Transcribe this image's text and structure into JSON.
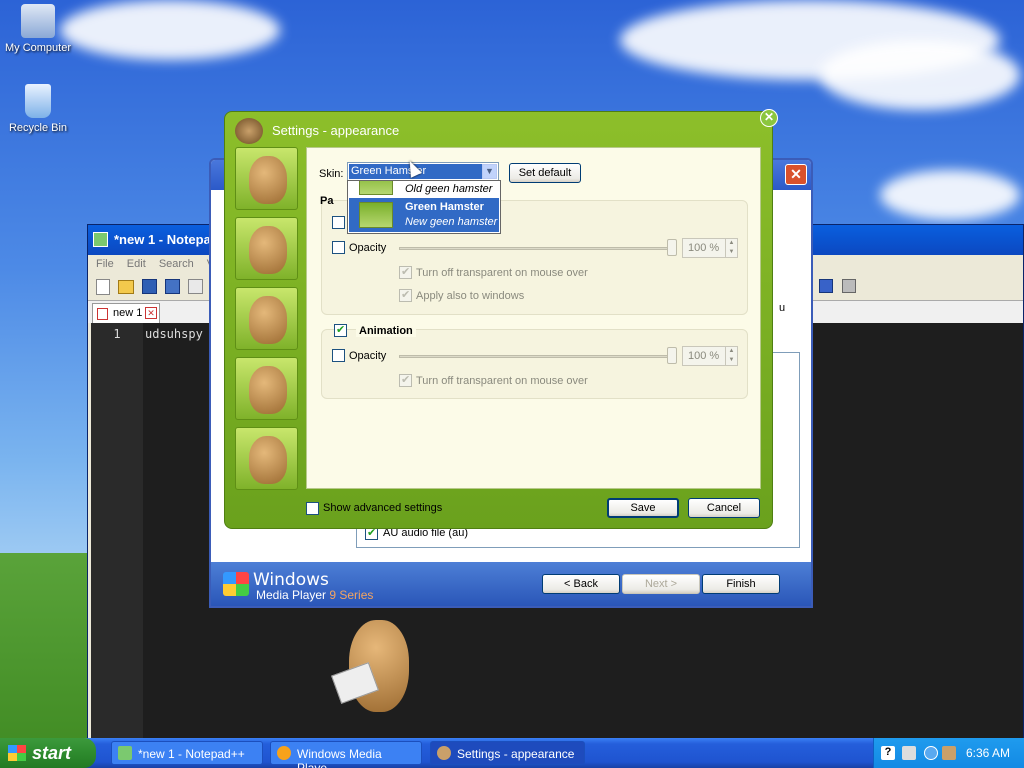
{
  "desktop": {
    "icons": [
      {
        "label": "My Computer",
        "icon": "my-computer-icon"
      },
      {
        "label": "Recycle Bin",
        "icon": "recycle-bin-icon"
      }
    ]
  },
  "notepad": {
    "title": "*new 1 - Notepa",
    "menu": [
      "File",
      "Edit",
      "Search",
      "Vi"
    ],
    "tab_label": "new 1",
    "line_number": "1",
    "code": "udsuhspy"
  },
  "wmp": {
    "list_item": "AU audio file (au)",
    "partial_text": "u",
    "brand_line1": "Windows",
    "brand_line2": "Media Player",
    "brand_series": "9 Series",
    "back_label": "< Back",
    "next_label": "Next >",
    "finish_label": "Finish"
  },
  "settings": {
    "title": "Settings - appearance",
    "skin_label": "Skin:",
    "skin_value": "Green Hamster",
    "set_default_label": "Set default",
    "group1": {
      "title_partial": "Pa",
      "opacity_label": "Opacity",
      "opacity_value": "100 %",
      "transparent_label": "Turn off transparent on mouse over",
      "apply_windows_label": "Apply also to windows"
    },
    "group2": {
      "title": "Animation",
      "opacity_label": "Opacity",
      "opacity_value": "100 %",
      "transparent_label": "Turn off transparent on mouse over"
    },
    "show_advanced_label": "Show advanced settings",
    "save_label": "Save",
    "cancel_label": "Cancel"
  },
  "skin_dropdown": {
    "options": [
      {
        "name": "",
        "desc": "Old geen hamster",
        "selected": false
      },
      {
        "name": "Green Hamster",
        "desc": "New geen hamster",
        "selected": true
      }
    ]
  },
  "taskbar": {
    "start_label": "start",
    "items": [
      {
        "label": "*new 1 - Notepad++",
        "icon": "notepad-icon"
      },
      {
        "label": "Windows Media Playe...",
        "icon": "media-player-icon"
      },
      {
        "label": "Settings - appearance",
        "icon": "settings-icon"
      }
    ],
    "clock": "6:36 AM"
  },
  "colors": {
    "xp_blue": "#245edb",
    "settings_green": "#7fb22a",
    "selection_blue": "#316ac5"
  }
}
